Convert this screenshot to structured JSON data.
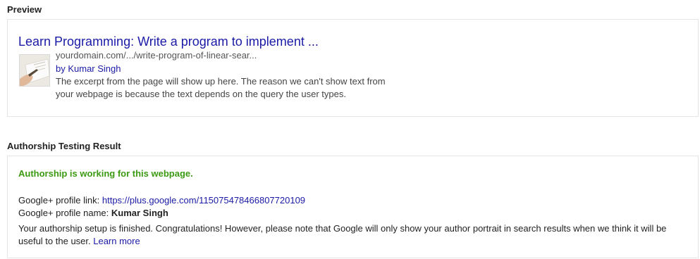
{
  "preview": {
    "heading": "Preview",
    "title": "Learn Programming: Write a program to implement ...",
    "url": "yourdomain.com/.../write-program-of-linear-sear...",
    "byline": "by Kumar Singh",
    "excerpt_line1": "The excerpt from the page will show up here. The reason we can't show text from",
    "excerpt_line2": "your webpage is because the text depends on the query the user types.",
    "thumbnail_icon": "document-hand-icon"
  },
  "result": {
    "heading": "Authorship Testing Result",
    "status": "Authorship is working for this webpage.",
    "profile_link_label": "Google+ profile link: ",
    "profile_link_url": "https://plus.google.com/115075478466807720109",
    "profile_name_label": "Google+ profile name: ",
    "profile_name": "Kumar Singh",
    "message_line1": "Your authorship setup is finished. Congratulations! However, please note that Google will only show your author portrait in search results when we think it will be",
    "message_line2": "useful to the user. ",
    "learn_more": "Learn more"
  },
  "colors": {
    "link": "#1a1aa6",
    "success": "#3c9a12",
    "border": "#e5e5e5"
  }
}
